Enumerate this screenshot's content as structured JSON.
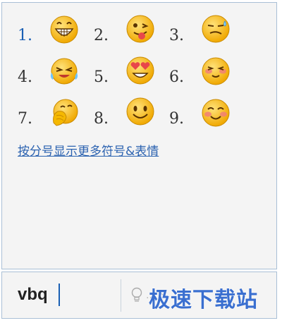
{
  "candidates": [
    {
      "num": "1.",
      "icon": "grinning-face-icon",
      "selected": true
    },
    {
      "num": "2.",
      "icon": "winking-tongue-face-icon",
      "selected": false
    },
    {
      "num": "3.",
      "icon": "sweating-face-icon",
      "selected": false
    },
    {
      "num": "4.",
      "icon": "crying-laughing-face-icon",
      "selected": false
    },
    {
      "num": "5.",
      "icon": "heart-eyes-face-icon",
      "selected": false
    },
    {
      "num": "6.",
      "icon": "blushing-happy-face-icon",
      "selected": false
    },
    {
      "num": "7.",
      "icon": "covering-mouth-face-icon",
      "selected": false
    },
    {
      "num": "8.",
      "icon": "smiling-face-icon",
      "selected": false
    },
    {
      "num": "9.",
      "icon": "shy-smile-face-icon",
      "selected": false
    }
  ],
  "more_link": "按分号显示更多符号&表情",
  "input": {
    "value": "vbq"
  },
  "hint": {
    "icon": "lightbulb-icon",
    "text": "...下"
  },
  "watermark": "极速下载站",
  "colors": {
    "face": "#f5b800",
    "selected_number": "#1a5fb4",
    "link": "#2b62b0"
  }
}
